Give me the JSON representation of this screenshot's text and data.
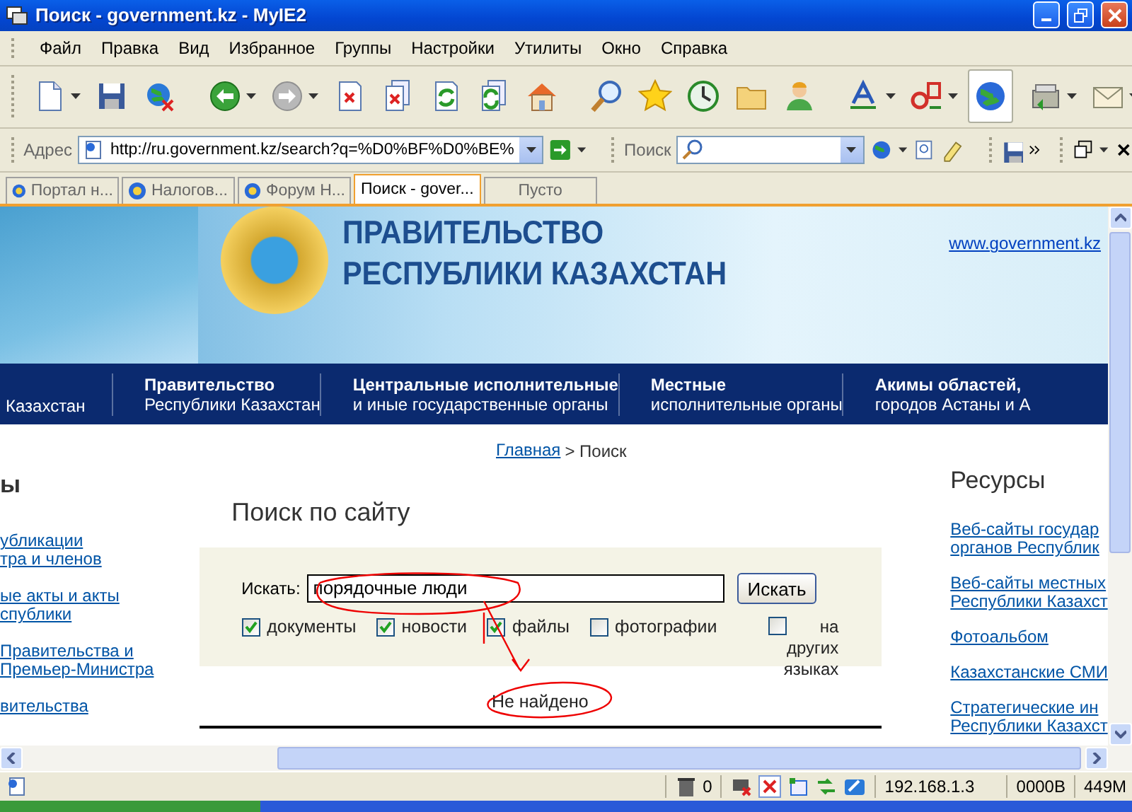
{
  "window": {
    "title": "Поиск - government.kz - MyIE2"
  },
  "menu": [
    "Файл",
    "Правка",
    "Вид",
    "Избранное",
    "Группы",
    "Настройки",
    "Утилиты",
    "Окно",
    "Справка"
  ],
  "address_bar": {
    "label": "Адрес",
    "value": "http://ru.government.kz/search?q=%D0%BF%D0%BE%"
  },
  "search_bar": {
    "label": "Поиск"
  },
  "tabs": [
    {
      "label": "Портал н...",
      "selected": false,
      "kind": "page"
    },
    {
      "label": "Налогов...",
      "selected": false,
      "kind": "page"
    },
    {
      "label": "Форум Н...",
      "selected": false,
      "kind": "page"
    },
    {
      "label": "Поиск - gover...",
      "selected": true,
      "kind": "page"
    },
    {
      "label": "Пусто",
      "selected": false,
      "kind": "empty"
    }
  ],
  "site": {
    "title_lines": [
      "ПРАВИТЕЛЬСТВО",
      "РЕСПУБЛИКИ КАЗАХСТАН"
    ],
    "url_link": "www.government.kz",
    "nav": [
      {
        "subtitle": "Казахстан"
      },
      {
        "title": "Правительство",
        "subtitle": "Республики Казахстан"
      },
      {
        "title": "Центральные исполнительные",
        "subtitle": "и иные государственные органы"
      },
      {
        "title": "Местные",
        "subtitle": "исполнительные органы"
      },
      {
        "title": "Акимы областей,",
        "subtitle": "городов Астаны и А"
      }
    ],
    "breadcrumb": {
      "link": "Главная",
      "rest": "> Поиск"
    },
    "left_heading": "ы",
    "left_links": [
      "убликации\nтра и членов",
      "ые акты и акты\nспублики",
      "Правительства и\nПремьер-Министра",
      "вительства"
    ],
    "search": {
      "heading": "Поиск по сайту",
      "label": "Искать:",
      "value": "порядочные люди",
      "button": "Искать",
      "options": [
        {
          "label": "документы",
          "checked": true
        },
        {
          "label": "новости",
          "checked": true
        },
        {
          "label": "файлы",
          "checked": true
        },
        {
          "label": "фотографии",
          "checked": false
        },
        {
          "label": "на других языках",
          "checked": false
        }
      ]
    },
    "result": "Не найдено",
    "resources": {
      "heading": "Ресурсы",
      "links": [
        "Веб-сайты государ\nорганов Республик",
        "Веб-сайты местных\nРеспублики Казахст",
        "Фотоальбом",
        "Казахстанские СМИ",
        "Стратегические ин\nРеспублики Казахст"
      ]
    }
  },
  "status_bar": {
    "trash_count": "0",
    "ip": "192.168.1.3",
    "traffic": "0000B",
    "memory": "449M"
  }
}
